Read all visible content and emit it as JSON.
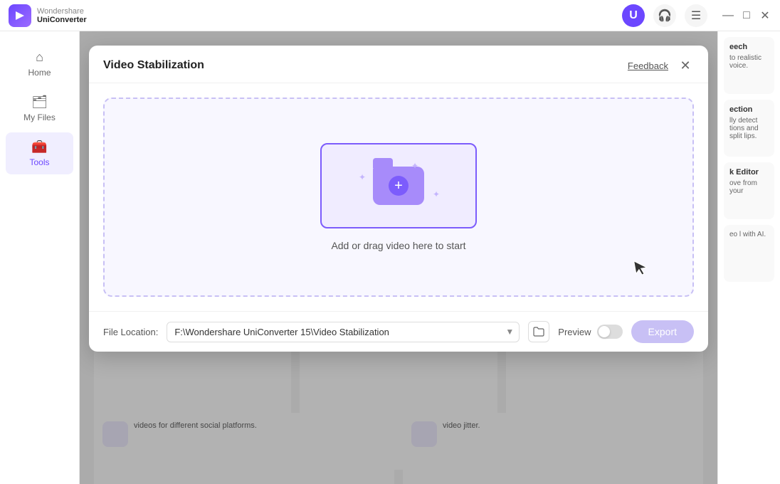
{
  "app": {
    "name": "UniConverter",
    "brand": "Wondershare"
  },
  "titlebar": {
    "avatar_label": "U",
    "headset_icon": "🎧",
    "menu_icon": "☰",
    "minimize_icon": "—",
    "maximize_icon": "□",
    "close_icon": "✕"
  },
  "sidebar": {
    "items": [
      {
        "label": "Home",
        "icon": "⌂",
        "active": false
      },
      {
        "label": "My Files",
        "icon": "📁",
        "active": false
      },
      {
        "label": "Tools",
        "icon": "🧰",
        "active": true
      }
    ]
  },
  "modal": {
    "title": "Video Stabilization",
    "feedback_label": "Feedback",
    "close_icon": "✕",
    "dropzone_text": "Add or drag video here to start",
    "footer": {
      "file_location_label": "File Location:",
      "file_location_value": "F:\\Wondershare UniConverter 15\\Video Stabilization",
      "preview_label": "Preview",
      "export_label": "Export"
    }
  },
  "right_panel": {
    "cards": [
      {
        "title": "Speech",
        "text": "to realistic voice."
      },
      {
        "title": "ection",
        "text": "lly detect tions and split lips."
      },
      {
        "title": "k Editor",
        "text": "ove from your"
      },
      {
        "title": "",
        "text": "eo l with AI."
      }
    ]
  },
  "bottom_cards": [
    {
      "text": "videos for different social platforms."
    },
    {
      "text": "video jitter."
    }
  ]
}
